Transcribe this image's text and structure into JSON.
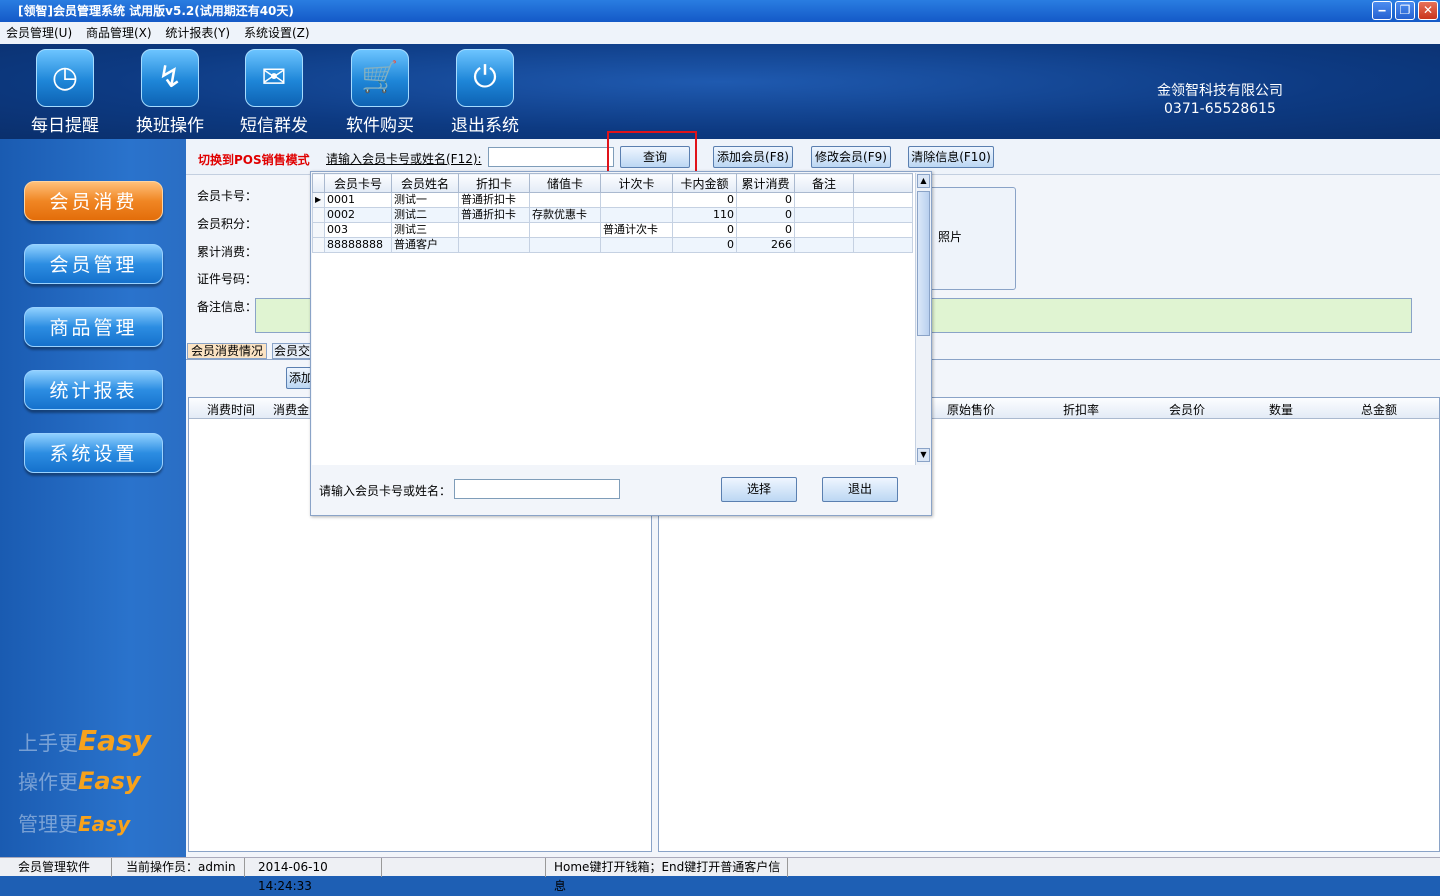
{
  "window": {
    "title": "[领智]会员管理系统 试用版v5.2(试用期还有40天)"
  },
  "menu": [
    "会员管理(U)",
    "商品管理(X)",
    "统计报表(Y)",
    "系统设置(Z)"
  ],
  "toolbar": [
    {
      "label": "每日提醒",
      "icon": "clock-icon",
      "glyph": "◷"
    },
    {
      "label": "换班操作",
      "icon": "shift-icon",
      "glyph": "↯"
    },
    {
      "label": "短信群发",
      "icon": "envelope-icon",
      "glyph": "✉"
    },
    {
      "label": "软件购买",
      "icon": "cart-icon",
      "glyph": "🛒"
    },
    {
      "label": "退出系统",
      "icon": "power-icon",
      "glyph": "⏻"
    }
  ],
  "company": {
    "name": "金领智科技有限公司",
    "phone": "0371-65528615"
  },
  "sidebar": [
    "会员消费",
    "会员管理",
    "商品管理",
    "统计报表",
    "系统设置"
  ],
  "slogans": [
    {
      "prefix": "上手更",
      "word": "Easy"
    },
    {
      "prefix": "操作更",
      "word": "Easy"
    },
    {
      "prefix": "管理更",
      "word": "Easy"
    }
  ],
  "main": {
    "pos_mode": "切换到POS销售模式",
    "search_label": "请输入会员卡号或姓名(F12):",
    "query_btn": "查询",
    "add_btn": "添加会员(F8)",
    "edit_btn": "修改会员(F9)",
    "clear_btn": "清除信息(F10)",
    "fields": [
      "会员卡号：",
      "会员积分：",
      "累计消费：",
      "证件号码："
    ],
    "remark_label": "备注信息：",
    "photo_label": "照片",
    "tabs": [
      "会员消费情况",
      "会员交"
    ],
    "add_small": "添加",
    "left_cols": [
      "消费时间",
      "消费金"
    ],
    "right_cols": [
      "原始售价",
      "折扣率",
      "会员价",
      "数量",
      "总金额"
    ]
  },
  "popup": {
    "columns": [
      "会员卡号",
      "会员姓名",
      "折扣卡",
      "储值卡",
      "计次卡",
      "卡内金额",
      "累计消费",
      "备注"
    ],
    "rows": [
      [
        "0001",
        "测试一",
        "普通折扣卡",
        "",
        "",
        "0",
        "0",
        ""
      ],
      [
        "0002",
        "测试二",
        "普通折扣卡",
        "存款优惠卡",
        "",
        "110",
        "0",
        ""
      ],
      [
        "003",
        "测试三",
        "",
        "",
        "普通计次卡",
        "0",
        "0",
        ""
      ],
      [
        "88888888",
        "普通客户",
        "",
        "",
        "",
        "0",
        "266",
        ""
      ]
    ],
    "search_label": "请输入会员卡号或姓名：",
    "select_btn": "选择",
    "exit_btn": "退出"
  },
  "status": [
    "会员管理软件",
    "当前操作员：admin",
    "2014-06-10 14:24:33",
    "Home键打开钱箱；End键打开普通客户信息"
  ],
  "colors": {
    "highlight": "#e0131a",
    "pos_mode": "#e00000"
  }
}
